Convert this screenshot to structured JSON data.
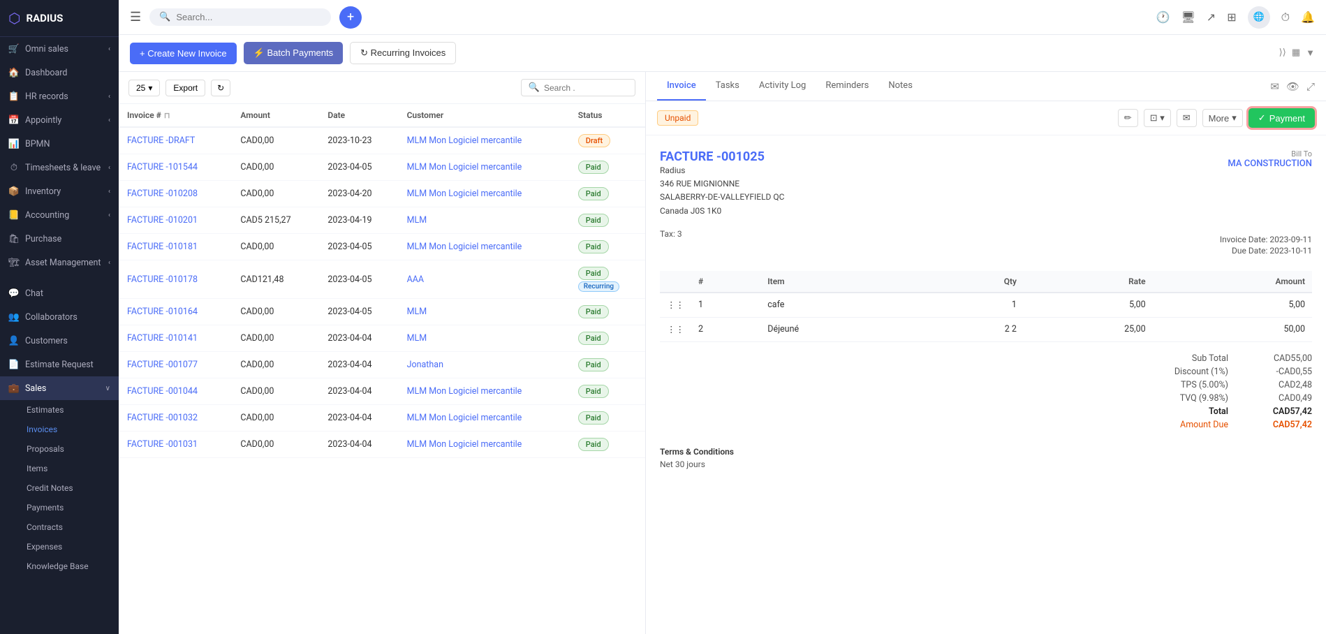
{
  "app": {
    "name": "RADIUS",
    "logo_text": "⬡ RADIUS"
  },
  "topnav": {
    "search_placeholder": "Search...",
    "icons": [
      "history-icon",
      "monitor-icon",
      "share-icon",
      "grid-icon",
      "globe-icon",
      "clock-icon",
      "bell-icon"
    ]
  },
  "sidebar": {
    "items": [
      {
        "id": "omni-sales",
        "label": "Omni sales",
        "icon": "🛒",
        "has_chevron": true,
        "has_badge": false
      },
      {
        "id": "dashboard",
        "label": "Dashboard",
        "icon": "🏠",
        "has_chevron": false,
        "has_badge": false
      },
      {
        "id": "hr-records",
        "label": "HR records",
        "icon": "📋",
        "has_chevron": true,
        "has_badge": false
      },
      {
        "id": "appointly",
        "label": "Appointly",
        "icon": "📅",
        "has_chevron": true,
        "has_badge": false
      },
      {
        "id": "bpmn",
        "label": "BPMN",
        "icon": "📊",
        "has_chevron": false,
        "has_badge": false
      },
      {
        "id": "timesheets",
        "label": "Timesheets & leave",
        "icon": "⏱",
        "has_chevron": true,
        "has_badge": false
      },
      {
        "id": "inventory",
        "label": "Inventory",
        "icon": "📦",
        "has_chevron": true,
        "has_badge": false
      },
      {
        "id": "accounting",
        "label": "Accounting",
        "icon": "📒",
        "has_chevron": true,
        "has_badge": false
      },
      {
        "id": "purchase",
        "label": "Purchase",
        "icon": "🛍",
        "has_chevron": false,
        "has_badge": false
      },
      {
        "id": "asset-management",
        "label": "Asset Management",
        "icon": "🏗",
        "has_chevron": true,
        "has_badge": false
      },
      {
        "id": "chat",
        "label": "Chat",
        "icon": "💬",
        "has_chevron": false,
        "has_badge": false
      },
      {
        "id": "collaborators",
        "label": "Collaborators",
        "icon": "👥",
        "has_chevron": false,
        "has_badge": false
      },
      {
        "id": "customers",
        "label": "Customers",
        "icon": "👤",
        "has_chevron": false,
        "has_badge": false
      },
      {
        "id": "estimate-request",
        "label": "Estimate Request",
        "icon": "📄",
        "has_chevron": false,
        "has_badge": false
      },
      {
        "id": "sales",
        "label": "Sales",
        "icon": "💼",
        "has_chevron": true,
        "has_badge": false,
        "active": true
      }
    ],
    "sales_sub_items": [
      {
        "id": "estimates",
        "label": "Estimates"
      },
      {
        "id": "invoices",
        "label": "Invoices",
        "active": true
      },
      {
        "id": "proposals",
        "label": "Proposals"
      },
      {
        "id": "items",
        "label": "Items"
      },
      {
        "id": "credit-notes",
        "label": "Credit Notes"
      },
      {
        "id": "payments",
        "label": "Payments"
      },
      {
        "id": "contracts",
        "label": "Contracts"
      },
      {
        "id": "expenses",
        "label": "Expenses"
      },
      {
        "id": "knowledge-base",
        "label": "Knowledge Base"
      }
    ]
  },
  "toolbar": {
    "create_label": "+ Create New Invoice",
    "batch_label": "⚡ Batch Payments",
    "recurring_label": "↻ Recurring Invoices"
  },
  "list_controls": {
    "per_page": "25",
    "export_label": "Export",
    "search_placeholder": "Search ."
  },
  "table": {
    "columns": [
      "Invoice #",
      "Amount",
      "Date",
      "Customer",
      "Status"
    ],
    "rows": [
      {
        "id": "FACTURE -DRAFT",
        "amount": "CAD0,00",
        "date": "2023-10-23",
        "customer": "MLM Mon Logiciel mercantile",
        "status": "Draft",
        "badge_type": "draft",
        "recurring": false
      },
      {
        "id": "FACTURE -101544",
        "amount": "CAD0,00",
        "date": "2023-04-05",
        "customer": "MLM Mon Logiciel mercantile",
        "status": "Paid",
        "badge_type": "paid",
        "recurring": false
      },
      {
        "id": "FACTURE -010208",
        "amount": "CAD0,00",
        "date": "2023-04-20",
        "customer": "MLM Mon Logiciel mercantile",
        "status": "Paid",
        "badge_type": "paid",
        "recurring": false
      },
      {
        "id": "FACTURE -010201",
        "amount": "CAD5 215,27",
        "date": "2023-04-19",
        "customer": "MLM",
        "status": "Paid",
        "badge_type": "paid",
        "recurring": false
      },
      {
        "id": "FACTURE -010181",
        "amount": "CAD0,00",
        "date": "2023-04-05",
        "customer": "MLM Mon Logiciel mercantile",
        "status": "Paid",
        "badge_type": "paid",
        "recurring": false
      },
      {
        "id": "FACTURE -010178",
        "amount": "CAD121,48",
        "date": "2023-04-05",
        "customer": "AAA",
        "status": "Paid",
        "badge_type": "paid",
        "recurring": true
      },
      {
        "id": "FACTURE -010164",
        "amount": "CAD0,00",
        "date": "2023-04-05",
        "customer": "MLM",
        "status": "Paid",
        "badge_type": "paid",
        "recurring": false
      },
      {
        "id": "FACTURE -010141",
        "amount": "CAD0,00",
        "date": "2023-04-04",
        "customer": "MLM",
        "status": "Paid",
        "badge_type": "paid",
        "recurring": false
      },
      {
        "id": "FACTURE -001077",
        "amount": "CAD0,00",
        "date": "2023-04-04",
        "customer": "Jonathan",
        "status": "Paid",
        "badge_type": "paid",
        "recurring": false
      },
      {
        "id": "FACTURE -001044",
        "amount": "CAD0,00",
        "date": "2023-04-04",
        "customer": "MLM Mon Logiciel mercantile",
        "status": "Paid",
        "badge_type": "paid",
        "recurring": false
      },
      {
        "id": "FACTURE -001032",
        "amount": "CAD0,00",
        "date": "2023-04-04",
        "customer": "MLM Mon Logiciel mercantile",
        "status": "Paid",
        "badge_type": "paid",
        "recurring": false
      },
      {
        "id": "FACTURE -001031",
        "amount": "CAD0,00",
        "date": "2023-04-04",
        "customer": "MLM Mon Logiciel mercantile",
        "status": "Paid",
        "badge_type": "paid",
        "recurring": false
      }
    ]
  },
  "detail": {
    "tabs": [
      "Invoice",
      "Tasks",
      "Activity Log",
      "Reminders",
      "Notes"
    ],
    "status_badge": "Unpaid",
    "payment_btn": "Payment",
    "more_label": "More",
    "invoice_number": "FACTURE -001025",
    "from": {
      "company": "Radius",
      "address1": "346 RUE MIGNIONNE",
      "address2": "SALABERRY-DE-VALLEYFIELD QC",
      "address3": "Canada J0S 1K0"
    },
    "bill_to_label": "Bill To",
    "bill_to": "MA CONSTRUCTION",
    "tax_label": "Tax: 3",
    "invoice_date_label": "Invoice Date:",
    "invoice_date": "2023-09-11",
    "due_date_label": "Due Date:",
    "due_date": "2023-10-11",
    "items": [
      {
        "num": "1",
        "item": "cafe",
        "qty": "1",
        "rate": "5,00",
        "amount": "5,00"
      },
      {
        "num": "2",
        "item": "Déjeuné",
        "qty": "2 2",
        "rate": "25,00",
        "amount": "50,00"
      }
    ],
    "totals": {
      "sub_total_label": "Sub Total",
      "sub_total": "CAD55,00",
      "discount_label": "Discount (1%)",
      "discount": "-CAD0,55",
      "tps_label": "TPS (5.00%)",
      "tps": "CAD2,48",
      "tvq_label": "TVQ (9.98%)",
      "tvq": "CAD0,49",
      "total_label": "Total",
      "total": "CAD57,42",
      "amount_due_label": "Amount Due",
      "amount_due": "CAD57,42"
    },
    "terms_title": "Terms & Conditions",
    "terms_text": "Net 30 jours"
  }
}
